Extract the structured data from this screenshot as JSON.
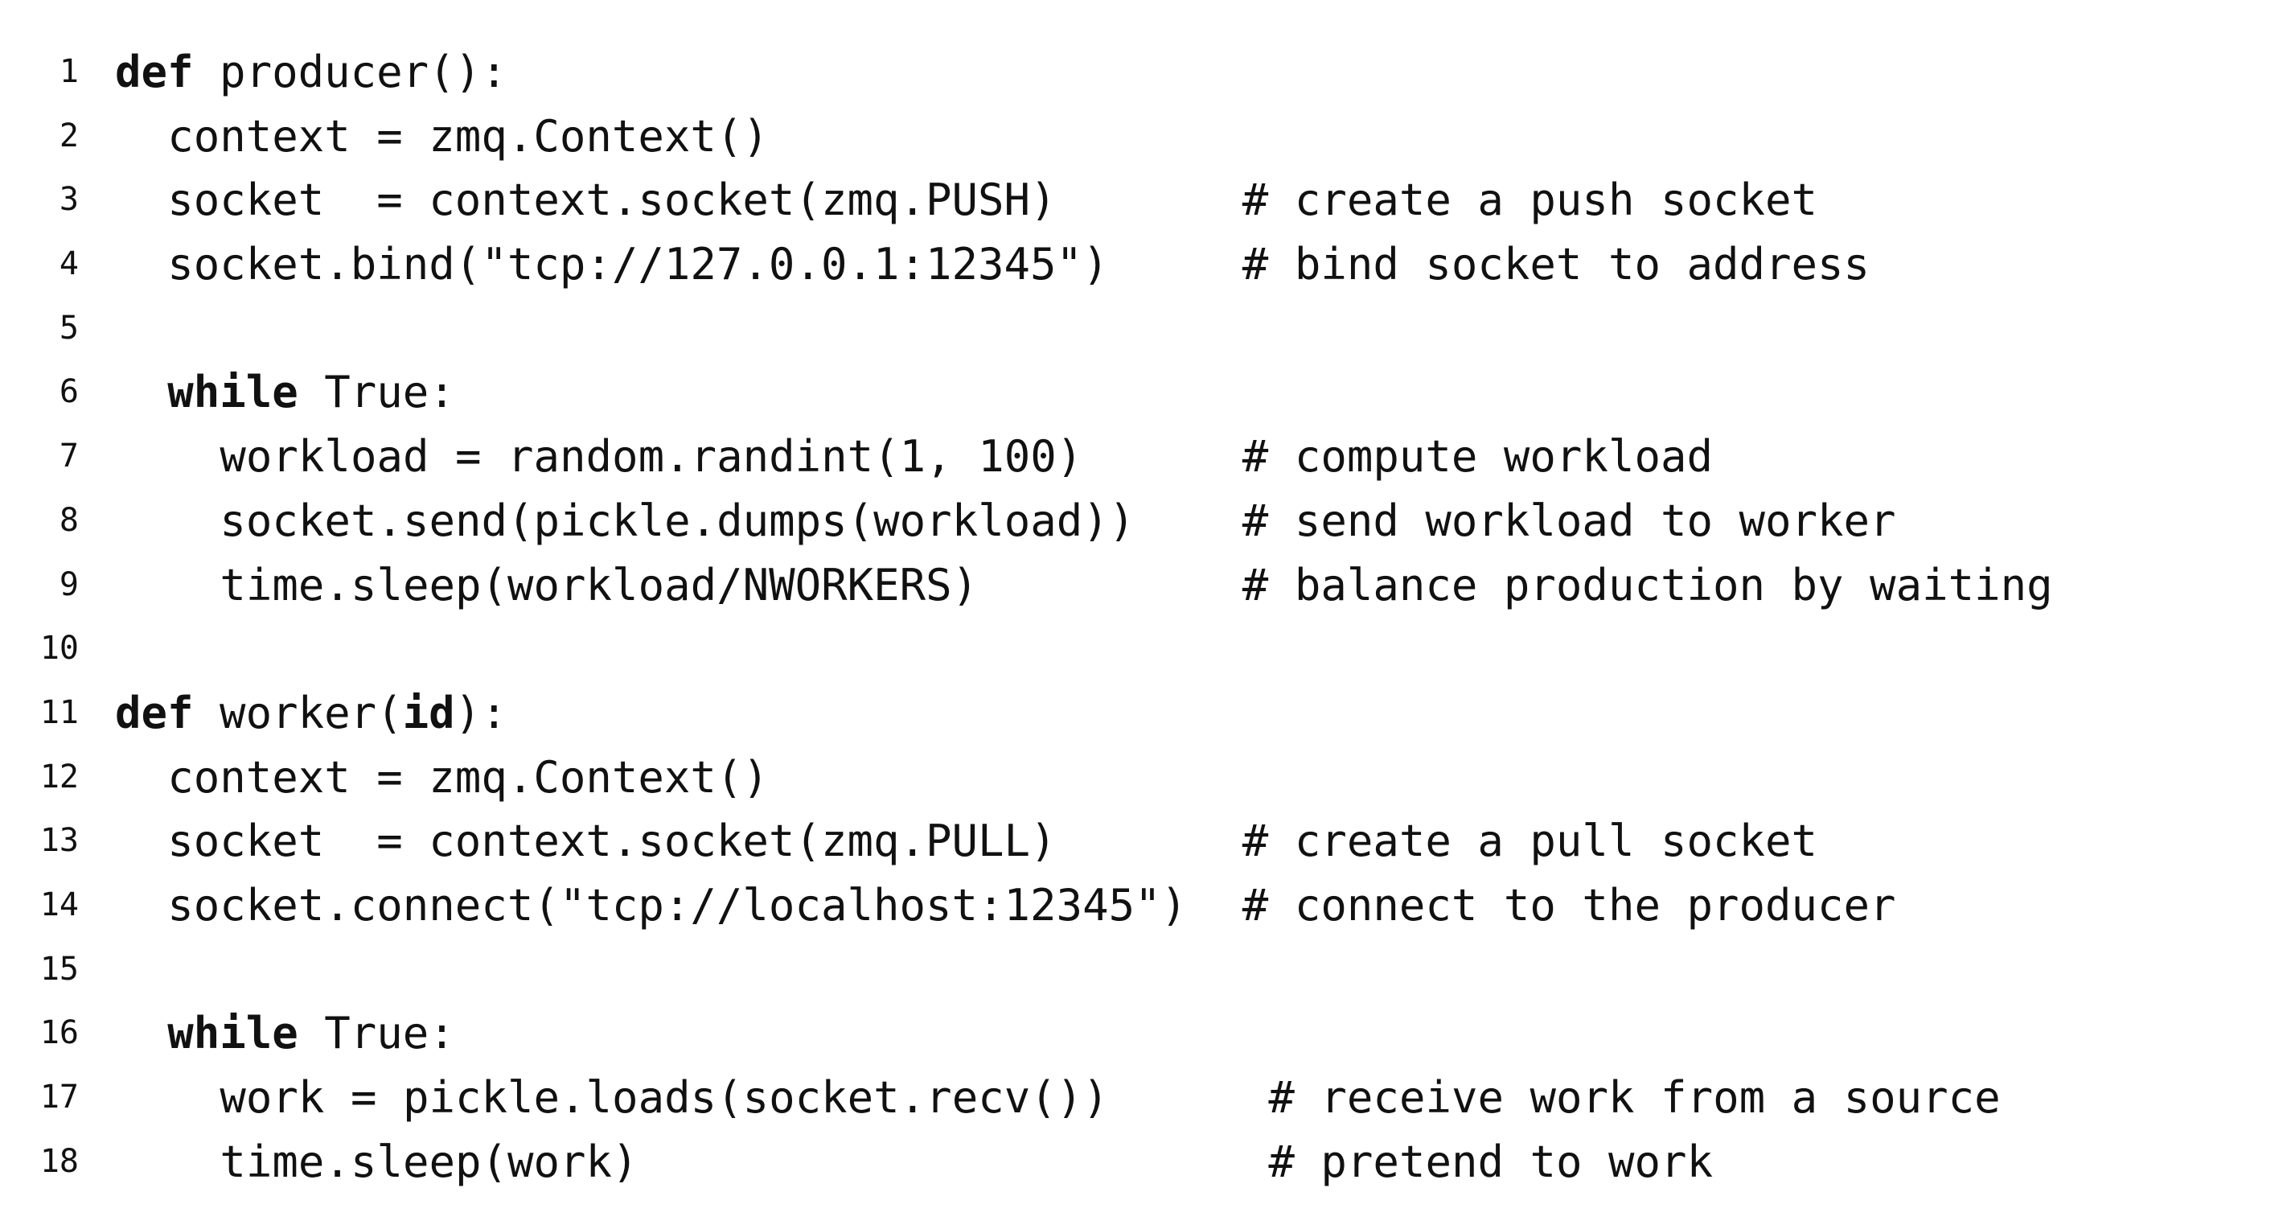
{
  "listing": {
    "lines": [
      {
        "number": "1",
        "indent": 0,
        "tokens": [
          {
            "text": "def",
            "kw": true
          },
          {
            "text": " producer():",
            "kw": false
          }
        ],
        "comment": "",
        "comment_col": 0
      },
      {
        "number": "2",
        "indent": 2,
        "tokens": [
          {
            "text": "context = zmq.Context()",
            "kw": false
          }
        ],
        "comment": "",
        "comment_col": 0
      },
      {
        "number": "3",
        "indent": 2,
        "tokens": [
          {
            "text": "socket  = context.socket(zmq.PUSH)",
            "kw": false
          }
        ],
        "comment": "# create a push socket",
        "comment_col": 43
      },
      {
        "number": "4",
        "indent": 2,
        "tokens": [
          {
            "text": "socket.bind(\"tcp://127.0.0.1:12345\")",
            "kw": false
          }
        ],
        "comment": "# bind socket to address",
        "comment_col": 43
      },
      {
        "number": "5",
        "indent": 0,
        "tokens": [],
        "comment": "",
        "comment_col": 0
      },
      {
        "number": "6",
        "indent": 2,
        "tokens": [
          {
            "text": "while",
            "kw": true
          },
          {
            "text": " True:",
            "kw": false
          }
        ],
        "comment": "",
        "comment_col": 0
      },
      {
        "number": "7",
        "indent": 4,
        "tokens": [
          {
            "text": "workload = random.randint(1, 100)",
            "kw": false
          }
        ],
        "comment": "# compute workload",
        "comment_col": 43
      },
      {
        "number": "8",
        "indent": 4,
        "tokens": [
          {
            "text": "socket.send(pickle.dumps(workload))",
            "kw": false
          }
        ],
        "comment": "# send workload to worker",
        "comment_col": 43
      },
      {
        "number": "9",
        "indent": 4,
        "tokens": [
          {
            "text": "time.sleep(workload/NWORKERS)",
            "kw": false
          }
        ],
        "comment": "# balance production by waiting",
        "comment_col": 43
      },
      {
        "number": "10",
        "indent": 0,
        "tokens": [],
        "comment": "",
        "comment_col": 0
      },
      {
        "number": "11",
        "indent": 0,
        "tokens": [
          {
            "text": "def",
            "kw": true
          },
          {
            "text": " worker(",
            "kw": false
          },
          {
            "text": "id",
            "kw": true
          },
          {
            "text": "):",
            "kw": false
          }
        ],
        "comment": "",
        "comment_col": 0
      },
      {
        "number": "12",
        "indent": 2,
        "tokens": [
          {
            "text": "context = zmq.Context()",
            "kw": false
          }
        ],
        "comment": "",
        "comment_col": 0
      },
      {
        "number": "13",
        "indent": 2,
        "tokens": [
          {
            "text": "socket  = context.socket(zmq.PULL)",
            "kw": false
          }
        ],
        "comment": "# create a pull socket",
        "comment_col": 43
      },
      {
        "number": "14",
        "indent": 2,
        "tokens": [
          {
            "text": "socket.connect(\"tcp://localhost:12345\")",
            "kw": false
          }
        ],
        "comment": "# connect to the producer",
        "comment_col": 43
      },
      {
        "number": "15",
        "indent": 0,
        "tokens": [],
        "comment": "",
        "comment_col": 0
      },
      {
        "number": "16",
        "indent": 2,
        "tokens": [
          {
            "text": "while",
            "kw": true
          },
          {
            "text": " True:",
            "kw": false
          }
        ],
        "comment": "",
        "comment_col": 0
      },
      {
        "number": "17",
        "indent": 4,
        "tokens": [
          {
            "text": "work = pickle.loads(socket.recv())",
            "kw": false
          }
        ],
        "comment": "# receive work from a source",
        "comment_col": 44
      },
      {
        "number": "18",
        "indent": 4,
        "tokens": [
          {
            "text": "time.sleep(work)",
            "kw": false
          }
        ],
        "comment": "# pretend to work",
        "comment_col": 44
      }
    ]
  }
}
